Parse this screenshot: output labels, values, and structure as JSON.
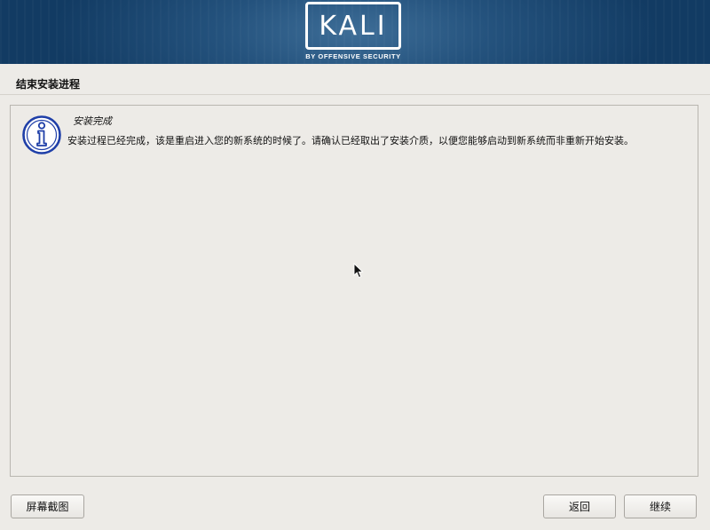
{
  "banner": {
    "logo_text": "KALI",
    "logo_subtitle": "BY OFFENSIVE SECURITY"
  },
  "page": {
    "title": "结束安装进程"
  },
  "dialog": {
    "icon": "info-icon",
    "title": "安装完成",
    "message": "安装过程已经完成，该是重启进入您的新系统的时候了。请确认已经取出了安装介质，以便您能够启动到新系统而非重新开始安装。"
  },
  "buttons": {
    "screenshot_label": "屏幕截图",
    "back_label": "返回",
    "continue_label": "继续"
  },
  "colors": {
    "banner_blue": "#24527d",
    "background": "#edebe7",
    "icon_blue": "#1f3fa8"
  }
}
